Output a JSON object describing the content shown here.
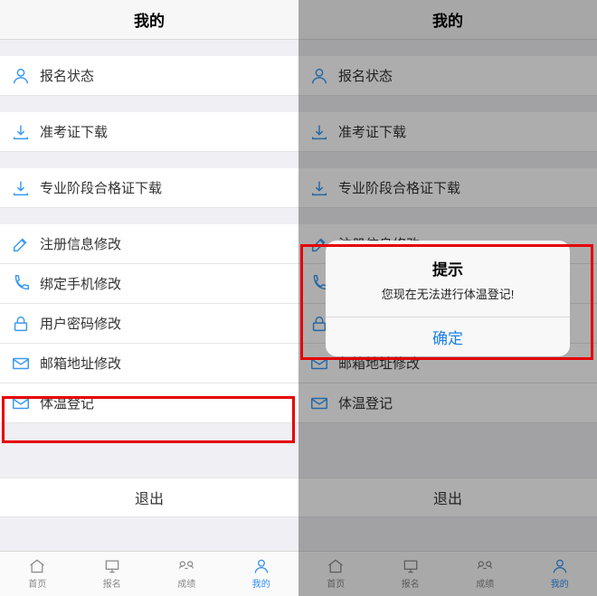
{
  "header": {
    "title": "我的"
  },
  "menu": {
    "registration_status": "报名状态",
    "admit_ticket_download": "准考证下载",
    "qualification_download": "专业阶段合格证下载",
    "reg_info_edit": "注册信息修改",
    "phone_edit": "绑定手机修改",
    "password_edit": "用户密码修改",
    "email_edit": "邮箱地址修改",
    "temperature_register": "体温登记"
  },
  "logout_label": "退出",
  "tabs": {
    "home": "首页",
    "signup": "报名",
    "scores": "成绩",
    "mine": "我的"
  },
  "alert": {
    "title": "提示",
    "message": "您现在无法进行体温登记!",
    "ok": "确定"
  }
}
